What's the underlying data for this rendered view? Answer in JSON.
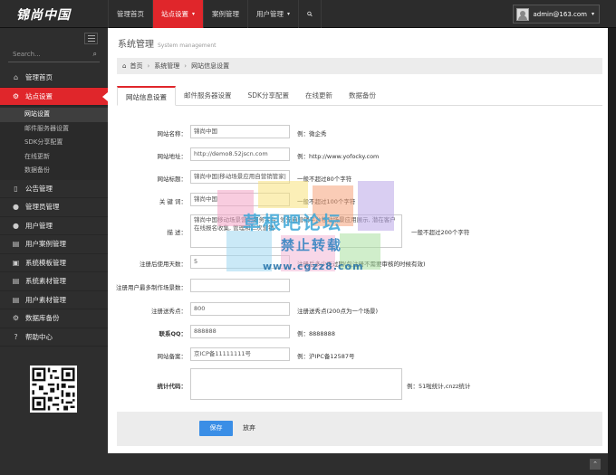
{
  "app": {
    "logo": "锦尚中国"
  },
  "topnav": {
    "items": [
      {
        "label": "管理首页"
      },
      {
        "label": "站点设置"
      },
      {
        "label": "案例管理"
      },
      {
        "label": "用户管理"
      }
    ],
    "user_email": "admin@163.com"
  },
  "sidebar": {
    "search_placeholder": "Search...",
    "items": [
      {
        "label": "管理首页",
        "icon": "home-icon"
      },
      {
        "label": "站点设置",
        "icon": "cogs-icon"
      },
      {
        "label": "公告管理",
        "icon": "bookmark-icon"
      },
      {
        "label": "管理员管理",
        "icon": "user-icon"
      },
      {
        "label": "用户管理",
        "icon": "user-icon"
      },
      {
        "label": "用户案例管理",
        "icon": "list-icon"
      },
      {
        "label": "系统模板管理",
        "icon": "briefcase-icon"
      },
      {
        "label": "系统素材管理",
        "icon": "list-icon"
      },
      {
        "label": "用户素材管理",
        "icon": "list-icon"
      },
      {
        "label": "数据库备份",
        "icon": "cogs-icon"
      },
      {
        "label": "帮助中心",
        "icon": "help-icon"
      }
    ],
    "subitems": [
      {
        "label": "网站设置"
      },
      {
        "label": "邮件服务器设置"
      },
      {
        "label": "SDK分享配置"
      },
      {
        "label": "在线更新"
      },
      {
        "label": "数据备份"
      }
    ]
  },
  "main": {
    "title": "系统管理",
    "subtitle": "System management",
    "breadcrumb": [
      "首页",
      "系统管理",
      "网站信息设置"
    ],
    "tabs": [
      "网站信息设置",
      "邮件服务器设置",
      "SDK分享配置",
      "在线更新",
      "数据备份"
    ],
    "fields": [
      {
        "label": "网站名称：",
        "value": "锦尚中国",
        "hint": "例：微企秀"
      },
      {
        "label": "网站地址：",
        "value": "http://demo8.52jscn.com",
        "hint": "例：http://www.yofocky.com"
      },
      {
        "label": "网站标题：",
        "value": "锦尚中国|移动场景应用自营销管家|",
        "hint": "一般不超过80个字符"
      },
      {
        "label": "关 键 词：",
        "value": "锦尚中国",
        "hint": "一般不超过100个字符"
      },
      {
        "label": "描 述：",
        "value": "锦尚中国移动场景营销服务平台, 领先自营销平台移动场景应用展示, 潜在客户在线报名收集, 管理和二次营销",
        "hint": "一般不超过200个字符"
      },
      {
        "label": "注册后使用天数：",
        "value": "5",
        "hint": "注册后多少天过期(包注册不需要审核的时候有效)"
      },
      {
        "label": "注册用户最多制作场景数：",
        "value": "",
        "hint": ""
      },
      {
        "label": "注册送秀点：",
        "value": "800",
        "hint": "注册送秀点(200点为一个场景)"
      },
      {
        "label": "联系QQ：",
        "value": "888888",
        "hint": "例：8888888"
      },
      {
        "label": "网站备案：",
        "value": "京ICP备11111111号",
        "hint": "例：沪IPC备12587号"
      },
      {
        "label": "统计代码：",
        "value": "",
        "hint": "例：51啦统计,cnzz统计"
      }
    ],
    "save_label": "保存",
    "cancel_label": "放弃"
  },
  "watermark": {
    "line1": "草根吧论坛",
    "line2": "禁止转载",
    "line3": "www.cgzz8.com"
  }
}
